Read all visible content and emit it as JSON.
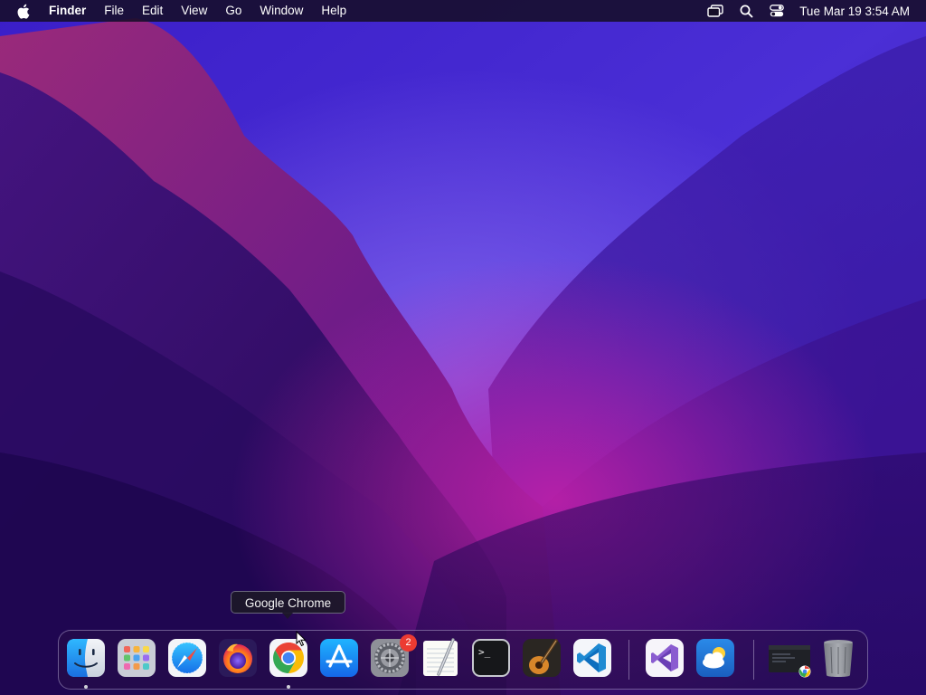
{
  "menubar": {
    "apple_icon": "apple-logo-icon",
    "app_name": "Finder",
    "menus": [
      "File",
      "Edit",
      "View",
      "Go",
      "Window",
      "Help"
    ],
    "status_icons": [
      "screen-mirroring-icon",
      "spotlight-search-icon",
      "control-center-icon"
    ],
    "clock": "Tue Mar 19  3:54 AM"
  },
  "tooltip": {
    "text": "Google Chrome"
  },
  "dock": {
    "apps": [
      {
        "name": "Finder",
        "icon": "finder-icon",
        "running": true
      },
      {
        "name": "Launchpad",
        "icon": "launchpad-icon",
        "running": false
      },
      {
        "name": "Safari",
        "icon": "safari-icon",
        "running": false
      },
      {
        "name": "Firefox",
        "icon": "firefox-icon",
        "running": false
      },
      {
        "name": "Google Chrome",
        "icon": "chrome-icon",
        "running": true
      },
      {
        "name": "App Store",
        "icon": "app-store-icon",
        "running": false
      },
      {
        "name": "System Preferences",
        "icon": "system-preferences-icon",
        "running": false,
        "badge": "2"
      },
      {
        "name": "TextEdit",
        "icon": "textedit-icon",
        "running": false
      },
      {
        "name": "Terminal",
        "icon": "terminal-icon",
        "running": false
      },
      {
        "name": "GarageBand",
        "icon": "garageband-icon",
        "running": false
      },
      {
        "name": "Visual Studio Code",
        "icon": "vscode-icon",
        "running": false
      },
      {
        "name": "Visual Studio",
        "icon": "visual-studio-icon",
        "running": false
      },
      {
        "name": "Weather",
        "icon": "weather-icon",
        "running": false
      },
      {
        "name": "Chrome Window",
        "icon": "minimized-window-icon",
        "running": false
      },
      {
        "name": "Trash",
        "icon": "trash-icon",
        "running": false
      }
    ]
  },
  "colors": {
    "menubar_bg": "#160e28",
    "badge": "#ec3b32",
    "wallpaper_deep": "#2a0a6a",
    "wallpaper_magenta": "#a0178c"
  }
}
